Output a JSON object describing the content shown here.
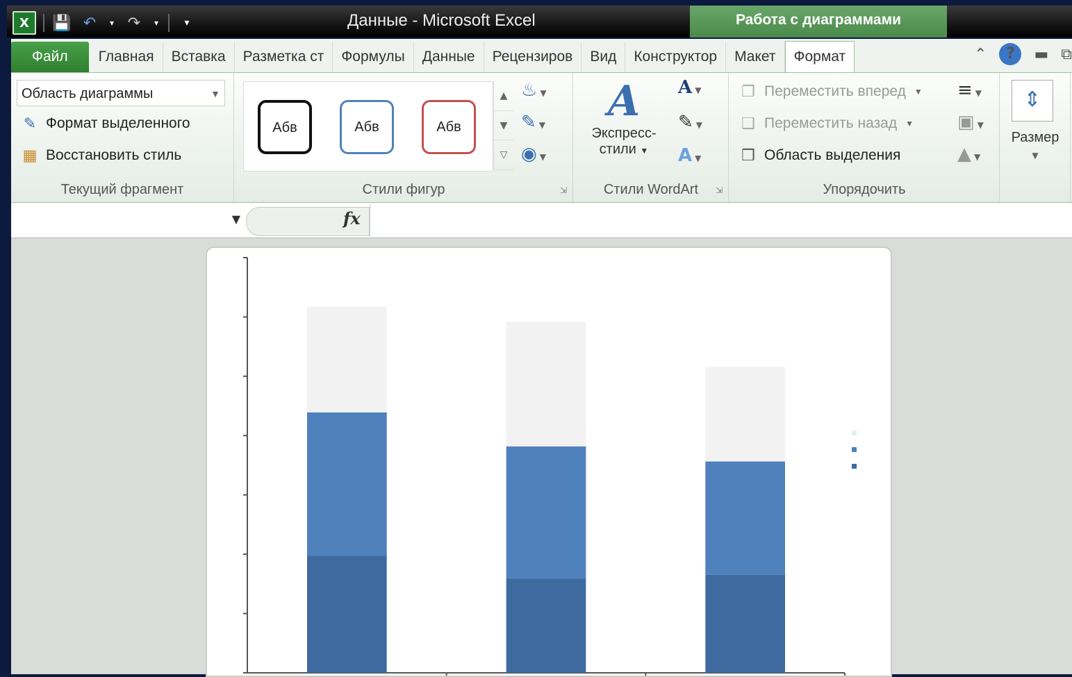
{
  "window": {
    "title": "Данные  -  Microsoft Excel",
    "context_tab": "Работа с диаграммами"
  },
  "qat": {
    "excel_icon": "excel-icon",
    "save_icon": "save-icon",
    "undo_icon": "undo-icon",
    "redo_icon": "redo-icon"
  },
  "tabs": [
    {
      "label": "Файл"
    },
    {
      "label": "Главная"
    },
    {
      "label": "Вставка"
    },
    {
      "label": "Разметка ст"
    },
    {
      "label": "Формулы"
    },
    {
      "label": "Данные"
    },
    {
      "label": "Рецензиров"
    },
    {
      "label": "Вид"
    },
    {
      "label": "Конструктор"
    },
    {
      "label": "Макет"
    },
    {
      "label": "Формат"
    }
  ],
  "ribbon": {
    "current_selection": {
      "combo_value": "Область диаграммы",
      "format_selection": "Формат выделенного",
      "reset_style": "Восстановить стиль",
      "label": "Текущий фрагмент"
    },
    "shape_styles": {
      "styles": [
        {
          "label": "Абв",
          "color": "#111111"
        },
        {
          "label": "Абв",
          "color": "#4f81bd"
        },
        {
          "label": "Абв",
          "color": "#c0504d"
        }
      ],
      "label": "Стили фигур"
    },
    "wordart_styles": {
      "express_line1": "Экспресс-",
      "express_line2": "стили",
      "label": "Стили WordArt"
    },
    "arrange": {
      "bring_forward": "Переместить вперед",
      "send_backward": "Переместить назад",
      "selection_pane": "Область выделения",
      "label": "Упорядочить"
    },
    "size": {
      "label": "Размер"
    }
  },
  "formula_bar": {
    "name_box": "",
    "fx_label": "fx",
    "formula": ""
  },
  "chart_data": {
    "type": "bar",
    "stacked": true,
    "categories": [
      "",
      "",
      ""
    ],
    "series": [
      {
        "values": [
          3.1,
          2.5,
          2.6
        ],
        "color": "#3f6aa0"
      },
      {
        "values": [
          3.8,
          3.5,
          3.0
        ],
        "color": "#4f81bd"
      },
      {
        "values": [
          2.8,
          3.3,
          2.5
        ],
        "color": "#f2f2f2"
      }
    ],
    "ylim": [
      0,
      11
    ],
    "y_ticks": 7,
    "grid": false
  },
  "colors": {
    "ribbon_green": "#4a8a4a",
    "accent_blue": "#4f81bd"
  }
}
